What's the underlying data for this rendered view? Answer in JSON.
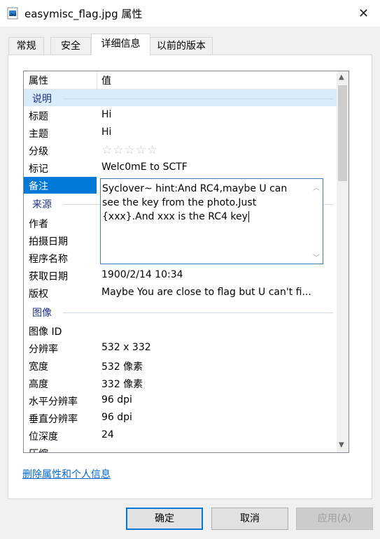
{
  "window": {
    "title": "easymisc_flag.jpg 属性",
    "close_glyph": "✕"
  },
  "tabs": [
    {
      "label": "常规"
    },
    {
      "label": "安全"
    },
    {
      "label": "详细信息"
    },
    {
      "label": "以前的版本"
    }
  ],
  "list": {
    "header_property": "属性",
    "header_value": "值",
    "groups": {
      "description": "说明",
      "origin": "来源",
      "image": "图像"
    },
    "rows": {
      "title": {
        "k": "标题",
        "v": "Hi"
      },
      "subject": {
        "k": "主题",
        "v": "Hi"
      },
      "rating": {
        "k": "分级",
        "v": "☆☆☆☆☆"
      },
      "tags": {
        "k": "标记",
        "v": "Welc0mE to SCTF"
      },
      "comments": {
        "k": "备注",
        "v": "Syclover~ hint:And RC4,maybe U can see the key from the photo.Just {xxx}.And xxx is the RC4 key"
      },
      "author": {
        "k": "作者",
        "v": ""
      },
      "date_taken": {
        "k": "拍摄日期",
        "v": ""
      },
      "program": {
        "k": "程序名称",
        "v": ""
      },
      "date_acquired": {
        "k": "获取日期",
        "v": "1900/2/14 10:34"
      },
      "copyright": {
        "k": "版权",
        "v": "Maybe You are close to flag but U can't fi..."
      },
      "image_id": {
        "k": "图像 ID",
        "v": ""
      },
      "dimensions": {
        "k": "分辨率",
        "v": "532 x 332"
      },
      "width": {
        "k": "宽度",
        "v": "532 像素"
      },
      "height": {
        "k": "高度",
        "v": "332 像素"
      },
      "h_resolution": {
        "k": "水平分辨率",
        "v": "96 dpi"
      },
      "v_resolution": {
        "k": "垂直分辨率",
        "v": "96 dpi"
      },
      "bit_depth": {
        "k": "位深度",
        "v": "24"
      },
      "compression": {
        "k": "压缩",
        "v": ""
      }
    }
  },
  "remove_link": "删除属性和个人信息",
  "buttons": {
    "ok": "确定",
    "cancel": "取消",
    "apply": "应用(A)"
  },
  "colors": {
    "accent": "#0078d7",
    "group_text": "#1e3287",
    "link": "#0066cc"
  }
}
